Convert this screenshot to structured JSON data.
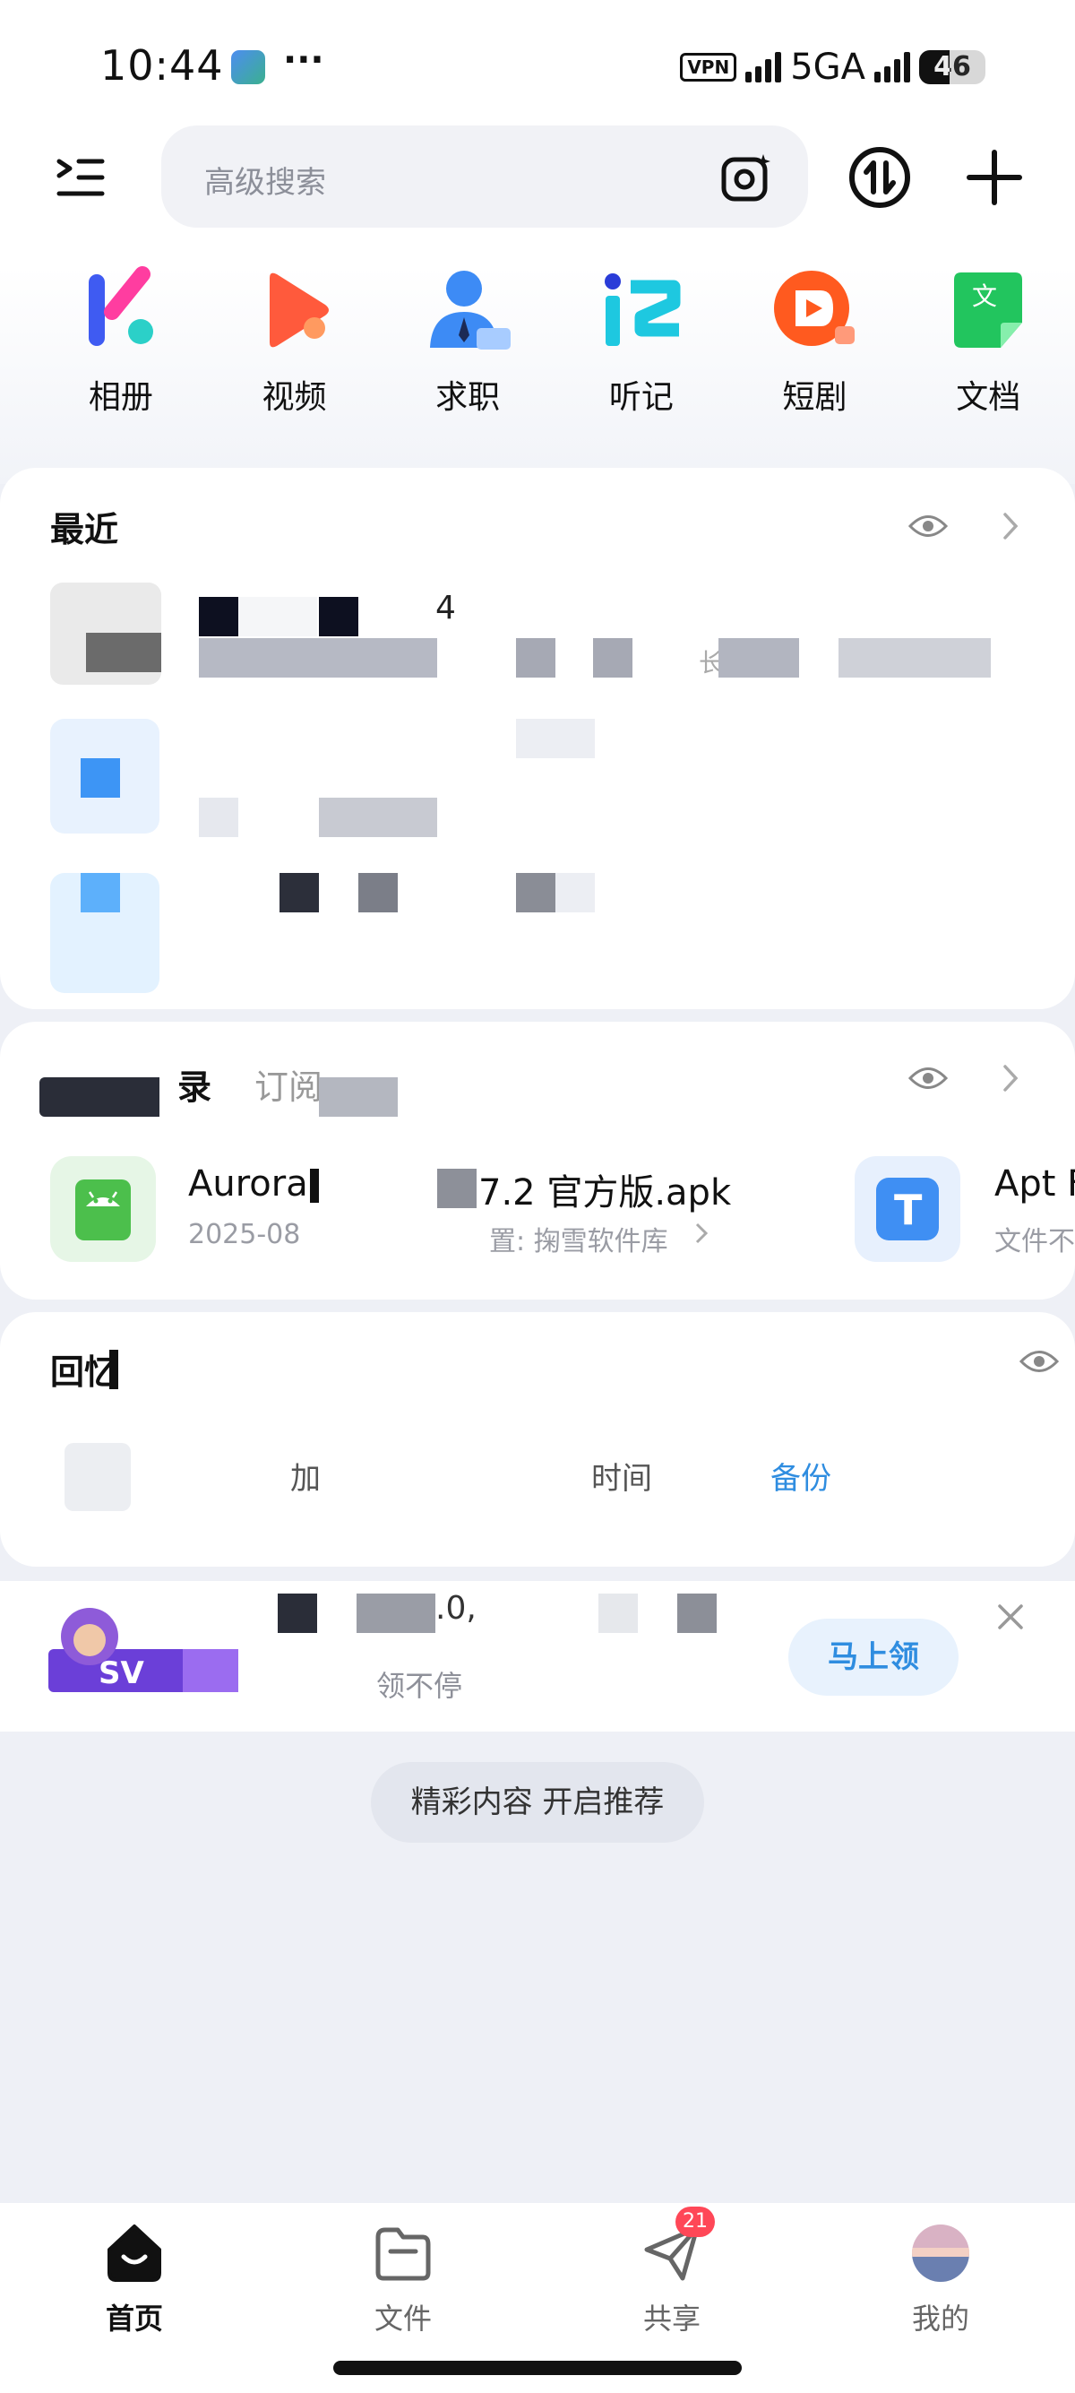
{
  "status_bar": {
    "time": "10:44",
    "more_indicator": "···",
    "vpn_label": "VPN",
    "network_type": "5GA",
    "battery_level": "46",
    "battery_fraction": 0.46
  },
  "header": {
    "search_placeholder": "高级搜索",
    "icons": [
      "menu-icon",
      "camera-scan-icon",
      "transfer-icon",
      "add-icon"
    ]
  },
  "quick_apps": [
    {
      "label": "相册",
      "icon": "album-icon"
    },
    {
      "label": "视频",
      "icon": "video-icon"
    },
    {
      "label": "求职",
      "icon": "job-icon"
    },
    {
      "label": "听记",
      "icon": "listen-note-icon"
    },
    {
      "label": "短剧",
      "icon": "short-drama-icon"
    },
    {
      "label": "文档",
      "icon": "document-icon"
    }
  ],
  "recent": {
    "title": "最近",
    "row1_visible_char": "4",
    "row1_visible_char2": "长"
  },
  "subscriptions": {
    "tab_partial": "录",
    "tab_subscribe": "订阅",
    "files": [
      {
        "name": "Aurora",
        "name_tail": "7.2 官方版.apk",
        "date": "2025-08",
        "source": "置: 掬雪软件库",
        "icon": "android-apk-icon"
      },
      {
        "name": "Apt F",
        "meta": "文件不",
        "icon": "text-file-icon"
      }
    ]
  },
  "memories": {
    "title": "回忆",
    "item1": "加",
    "item2": "时间",
    "item3": "备份"
  },
  "promo": {
    "badge_text": "SV",
    "title_fragment": ".0,",
    "subtitle": "领不停",
    "button": "马上领"
  },
  "recommend_button": "精彩内容 开启推荐",
  "bottom_nav": [
    {
      "label": "首页",
      "icon": "home-icon",
      "active": true
    },
    {
      "label": "文件",
      "icon": "folder-icon",
      "active": false
    },
    {
      "label": "共享",
      "icon": "share-icon",
      "active": false,
      "badge": "21"
    },
    {
      "label": "我的",
      "icon": "avatar-icon",
      "active": false
    }
  ],
  "colors": {
    "accent_blue": "#2f8de0",
    "badge_red": "#ff4757",
    "page_bg": "#eef0f6"
  }
}
